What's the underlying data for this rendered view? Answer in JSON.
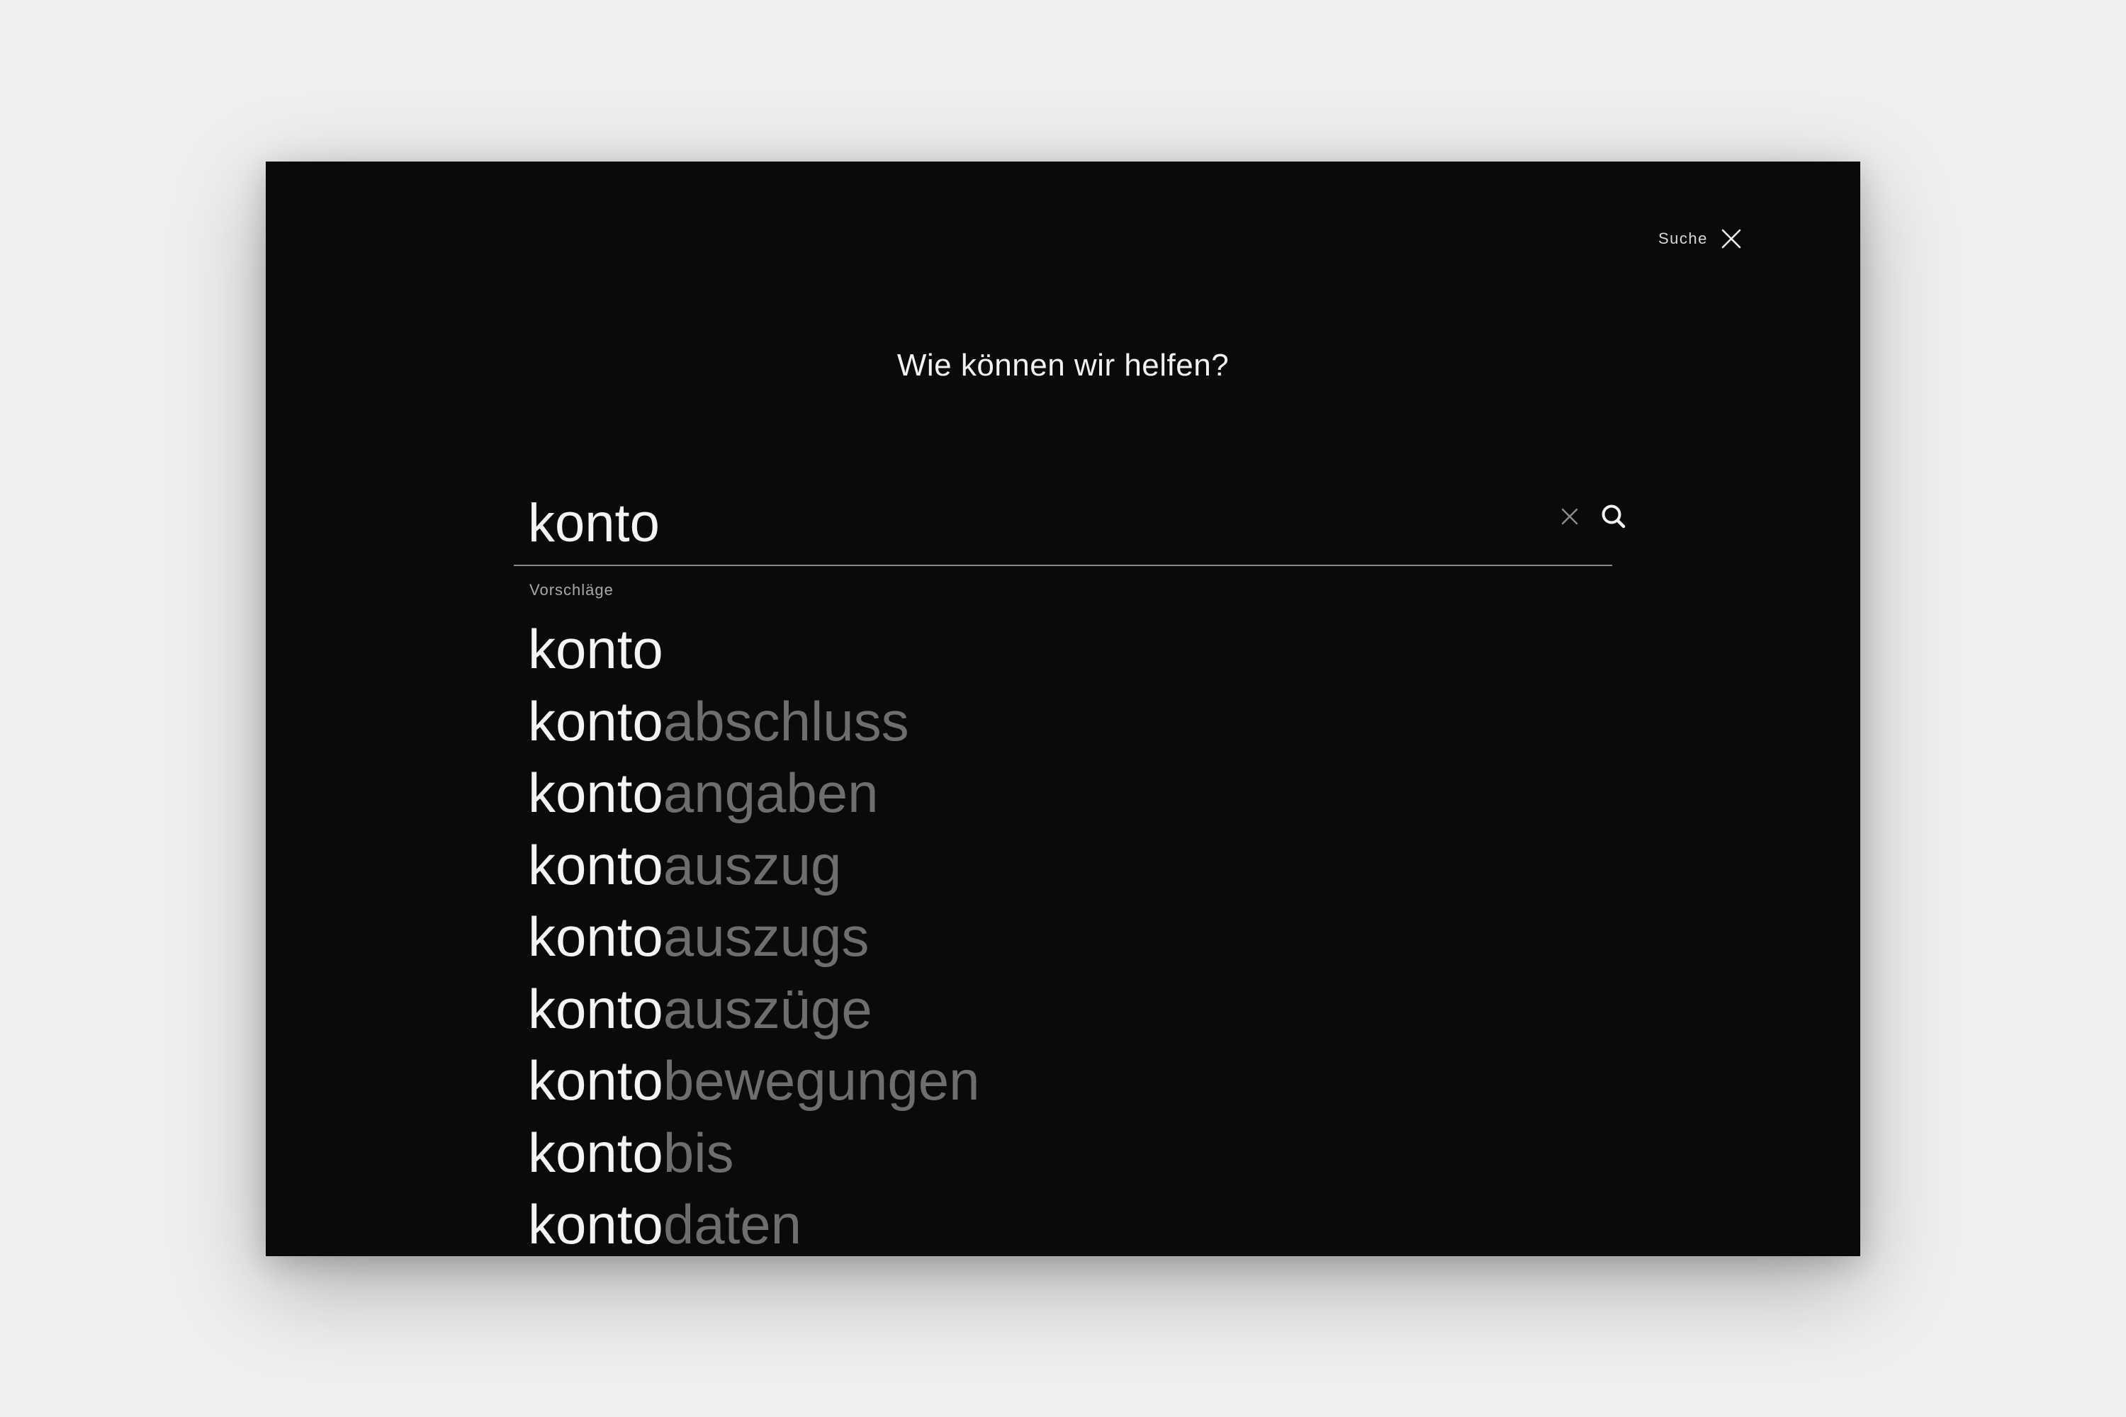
{
  "header": {
    "close_label": "Suche"
  },
  "page_title": "Wie können wir helfen?",
  "search": {
    "query": "konto",
    "placeholder": "",
    "clear_icon": "close-icon",
    "submit_icon": "search-icon"
  },
  "suggestions": {
    "heading": "Vorschläge",
    "items": [
      {
        "typed": "konto",
        "completion": ""
      },
      {
        "typed": "konto",
        "completion": "abschluss"
      },
      {
        "typed": "konto",
        "completion": "angaben"
      },
      {
        "typed": "konto",
        "completion": "auszug"
      },
      {
        "typed": "konto",
        "completion": "auszugs"
      },
      {
        "typed": "konto",
        "completion": "auszüge"
      },
      {
        "typed": "konto",
        "completion": "bewegungen"
      },
      {
        "typed": "konto",
        "completion": "bis"
      },
      {
        "typed": "konto",
        "completion": "daten"
      }
    ]
  },
  "colors": {
    "page_background": "#efefef",
    "panel_background": "#0a0a0a",
    "text_primary": "#f4f4f4",
    "text_completion": "#6e6e6e",
    "text_muted": "#a8a8a8",
    "divider": "#8a8a8a"
  }
}
